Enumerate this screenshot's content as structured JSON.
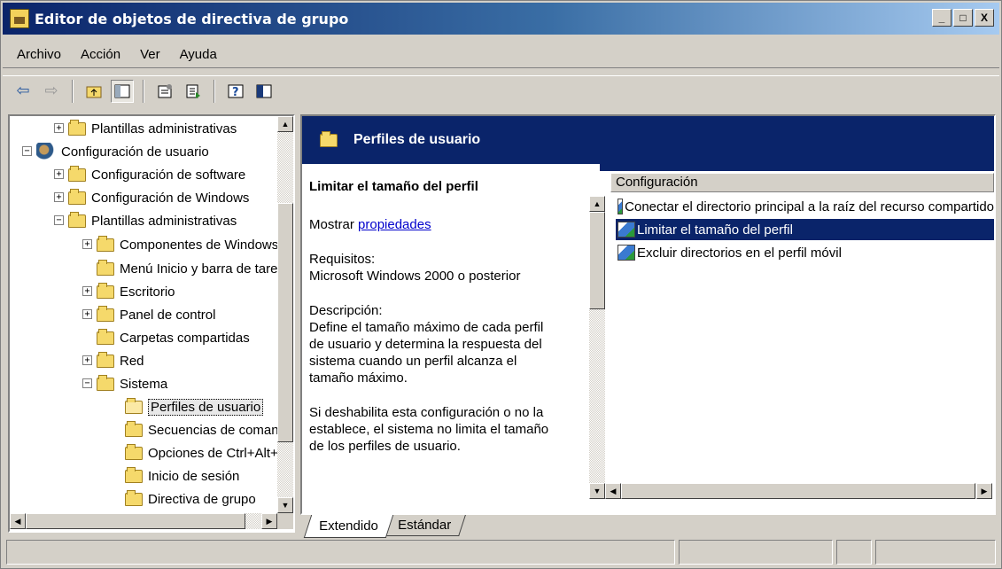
{
  "window": {
    "title": "Editor de objetos de directiva de grupo",
    "minimize_glyph": "_",
    "maximize_glyph": "□",
    "close_glyph": "X"
  },
  "menu": [
    "Archivo",
    "Acción",
    "Ver",
    "Ayuda"
  ],
  "toolbar_icons": [
    "back-arrow-icon",
    "forward-arrow-icon",
    "up-folder-icon",
    "show-hide-tree-icon",
    "properties-icon",
    "export-list-icon",
    "help-icon",
    "extended-view-icon"
  ],
  "tree": {
    "items": [
      {
        "label": "Plantillas administrativas"
      },
      {
        "label": "Configuración de usuario"
      },
      {
        "label": "Configuración de software"
      },
      {
        "label": "Configuración de Windows"
      },
      {
        "label": "Plantillas administrativas"
      },
      {
        "label": "Componentes de Windows"
      },
      {
        "label": "Menú Inicio y barra de tareas"
      },
      {
        "label": "Escritorio"
      },
      {
        "label": "Panel de control"
      },
      {
        "label": "Carpetas compartidas"
      },
      {
        "label": "Red"
      },
      {
        "label": "Sistema"
      },
      {
        "label": "Perfiles de usuario"
      },
      {
        "label": "Secuencias de comandos"
      },
      {
        "label": "Opciones de Ctrl+Alt+Supr"
      },
      {
        "label": "Inicio de sesión"
      },
      {
        "label": "Directiva de grupo"
      }
    ]
  },
  "details": {
    "header_title": "Perfiles de usuario",
    "selected_title": "Limitar el tamaño del perfil",
    "show_prefix": "Mostrar ",
    "show_link": "propiedades",
    "requirements_label": "Requisitos:",
    "requirements_value": "Microsoft Windows 2000 o posterior",
    "description_label": "Descripción:",
    "description_text": "Define el tamaño máximo de cada perfil de usuario y determina la respuesta del sistema cuando un perfil alcanza el tamaño máximo.",
    "description_text2": "Si deshabilita esta configuración o no la establece, el sistema no limita el tamaño de los perfiles de usuario."
  },
  "list": {
    "column_header": "Configuración",
    "rows": [
      {
        "label": "Conectar el directorio principal a la raíz del recurso compartido"
      },
      {
        "label": "Limitar el tamaño del perfil"
      },
      {
        "label": "Excluir directorios en el perfil móvil"
      }
    ]
  },
  "tabs": [
    "Extendido",
    "Estándar"
  ]
}
